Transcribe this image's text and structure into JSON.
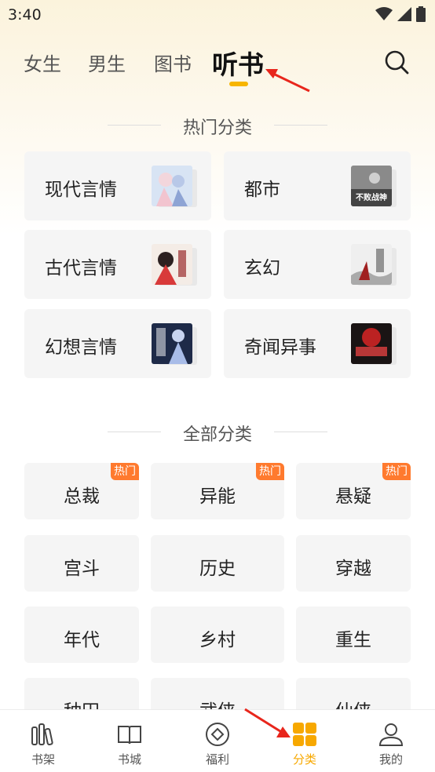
{
  "status": {
    "time": "3:40"
  },
  "tabs": [
    {
      "label": "女生"
    },
    {
      "label": "男生"
    },
    {
      "label": "图书"
    },
    {
      "label": "听书",
      "active": true
    }
  ],
  "hot_section": {
    "title": "热门分类",
    "items": [
      {
        "label": "现代言情",
        "cover_icon": "romance-cover"
      },
      {
        "label": "都市",
        "cover_icon": "urban-cover",
        "cover_text": "不败战神"
      },
      {
        "label": "古代言情",
        "cover_icon": "ancient-romance-cover"
      },
      {
        "label": "玄幻",
        "cover_icon": "fantasy-cover"
      },
      {
        "label": "幻想言情",
        "cover_icon": "fantasy-romance-cover"
      },
      {
        "label": "奇闻异事",
        "cover_icon": "mystery-cover"
      }
    ]
  },
  "all_section": {
    "title": "全部分类",
    "hot_badge": "热门",
    "items": [
      {
        "label": "总裁",
        "hot": true
      },
      {
        "label": "异能",
        "hot": true
      },
      {
        "label": "悬疑",
        "hot": true
      },
      {
        "label": "宫斗"
      },
      {
        "label": "历史"
      },
      {
        "label": "穿越"
      },
      {
        "label": "年代"
      },
      {
        "label": "乡村"
      },
      {
        "label": "重生"
      },
      {
        "label": "种田"
      },
      {
        "label": "武侠"
      },
      {
        "label": "仙侠"
      }
    ]
  },
  "bottom_nav": [
    {
      "label": "书架",
      "icon": "bookshelf-icon"
    },
    {
      "label": "书城",
      "icon": "book-open-icon"
    },
    {
      "label": "福利",
      "icon": "welfare-icon"
    },
    {
      "label": "分类",
      "icon": "category-grid-icon",
      "active": true
    },
    {
      "label": "我的",
      "icon": "user-icon"
    }
  ],
  "colors": {
    "accent": "#f7b500",
    "active_nav": "#f7a800",
    "hot_badge": "#ff7a2e",
    "annotation_arrow": "#e8261c",
    "card_bg": "#f5f5f5"
  }
}
